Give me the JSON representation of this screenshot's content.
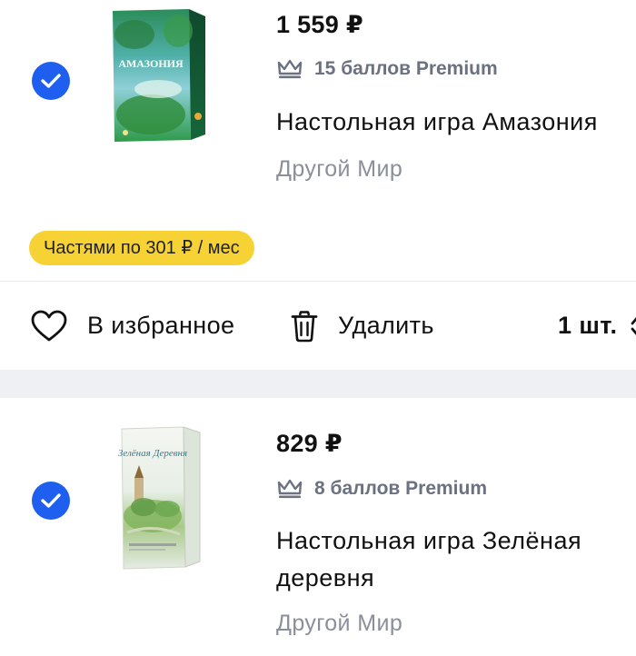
{
  "items": [
    {
      "price": "1 559 ₽",
      "points": "15 баллов Premium",
      "title": "Настольная игра Амазония",
      "brand": "Другой Мир",
      "installment": "Частями по 301 ₽ / мес",
      "box_text": "АМАЗОНИЯ"
    },
    {
      "price": "829 ₽",
      "points": "8 баллов Premium",
      "title": "Настольная игра Зелёная деревня",
      "brand": "Другой Мир",
      "box_text": "Зелёная Деревня"
    }
  ],
  "actions": {
    "favorite_label": "В избранное",
    "delete_label": "Удалить",
    "quantity_label": "1 шт."
  },
  "colors": {
    "accent": "#1f5ff0",
    "installment_bg": "#f7d234",
    "muted_text": "#6b7180",
    "divider": "#e6e8ec",
    "section_gap": "#eef0f3"
  },
  "icons": [
    "checkmark-icon",
    "crown-icon",
    "heart-icon",
    "trash-icon",
    "chevron-icon"
  ]
}
